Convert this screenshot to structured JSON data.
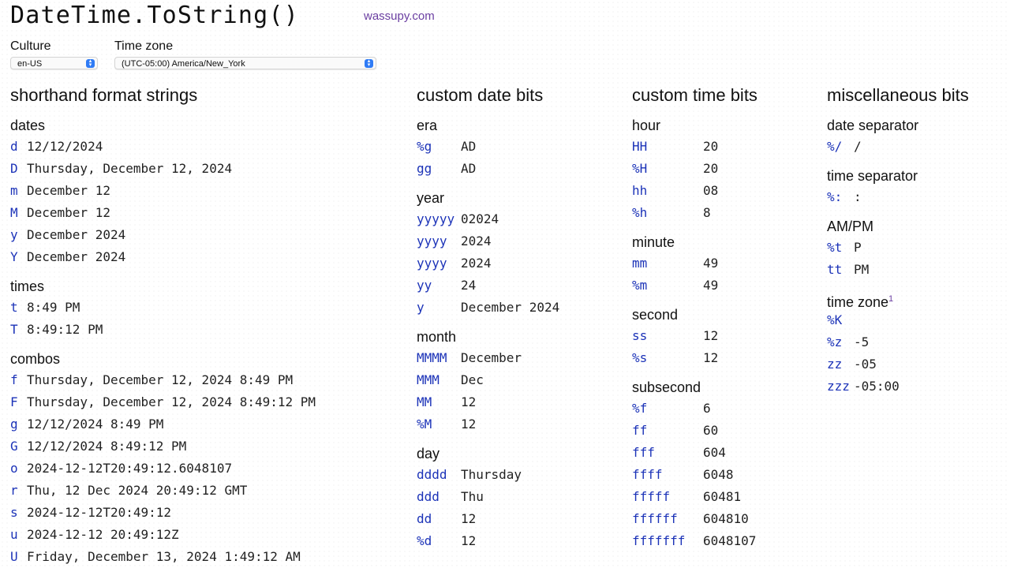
{
  "header": {
    "title": "DateTime.ToString()",
    "site_link": "wassupy.com"
  },
  "controls": {
    "culture_label": "Culture",
    "culture_value": "en-US",
    "timezone_label": "Time zone",
    "timezone_value": "(UTC-05:00) America/New_York"
  },
  "shorthand": {
    "heading": "shorthand format strings",
    "groups": [
      {
        "label": "dates",
        "rows": [
          {
            "code": "d",
            "value": "12/12/2024"
          },
          {
            "code": "D",
            "value": "Thursday, December 12, 2024"
          },
          {
            "code": "m",
            "value": "December 12"
          },
          {
            "code": "M",
            "value": "December 12"
          },
          {
            "code": "y",
            "value": "December 2024"
          },
          {
            "code": "Y",
            "value": "December 2024"
          }
        ]
      },
      {
        "label": "times",
        "rows": [
          {
            "code": "t",
            "value": "8:49 PM"
          },
          {
            "code": "T",
            "value": "8:49:12 PM"
          }
        ]
      },
      {
        "label": "combos",
        "rows": [
          {
            "code": "f",
            "value": "Thursday, December 12, 2024 8:49 PM"
          },
          {
            "code": "F",
            "value": "Thursday, December 12, 2024 8:49:12 PM"
          },
          {
            "code": "g",
            "value": "12/12/2024 8:49 PM"
          },
          {
            "code": "G",
            "value": "12/12/2024 8:49:12 PM"
          },
          {
            "code": "o",
            "value": "2024-12-12T20:49:12.6048107"
          },
          {
            "code": "r",
            "value": "Thu, 12 Dec 2024 20:49:12 GMT"
          },
          {
            "code": "s",
            "value": "2024-12-12T20:49:12"
          },
          {
            "code": "u",
            "value": "2024-12-12 20:49:12Z"
          },
          {
            "code": "U",
            "value": "Friday, December 13, 2024 1:49:12 AM"
          }
        ]
      }
    ]
  },
  "custom_date": {
    "heading": "custom date bits",
    "groups": [
      {
        "label": "era",
        "rows": [
          {
            "code": "%g",
            "value": "AD"
          },
          {
            "code": "gg",
            "value": "AD"
          }
        ]
      },
      {
        "label": "year",
        "rows": [
          {
            "code": "yyyyy",
            "value": "02024"
          },
          {
            "code": "yyyy",
            "value": "2024"
          },
          {
            "code": "yyyy",
            "value": "2024"
          },
          {
            "code": "yy",
            "value": "24"
          },
          {
            "code": "y",
            "value": "December 2024"
          }
        ]
      },
      {
        "label": "month",
        "rows": [
          {
            "code": "MMMM",
            "value": "December"
          },
          {
            "code": "MMM",
            "value": "Dec"
          },
          {
            "code": "MM",
            "value": "12"
          },
          {
            "code": "%M",
            "value": "12"
          }
        ]
      },
      {
        "label": "day",
        "rows": [
          {
            "code": "dddd",
            "value": "Thursday"
          },
          {
            "code": "ddd",
            "value": "Thu"
          },
          {
            "code": "dd",
            "value": "12"
          },
          {
            "code": "%d",
            "value": "12"
          }
        ]
      }
    ]
  },
  "custom_time": {
    "heading": "custom time bits",
    "groups": [
      {
        "label": "hour",
        "rows": [
          {
            "code": "HH",
            "value": "20"
          },
          {
            "code": "%H",
            "value": "20"
          },
          {
            "code": "hh",
            "value": "08"
          },
          {
            "code": "%h",
            "value": "8"
          }
        ]
      },
      {
        "label": "minute",
        "rows": [
          {
            "code": "mm",
            "value": "49"
          },
          {
            "code": "%m",
            "value": "49"
          }
        ]
      },
      {
        "label": "second",
        "rows": [
          {
            "code": "ss",
            "value": "12"
          },
          {
            "code": "%s",
            "value": "12"
          }
        ]
      },
      {
        "label": "subsecond",
        "rows": [
          {
            "code": "%f",
            "value": "6"
          },
          {
            "code": "ff",
            "value": "60"
          },
          {
            "code": "fff",
            "value": "604"
          },
          {
            "code": "ffff",
            "value": "6048"
          },
          {
            "code": "fffff",
            "value": "60481"
          },
          {
            "code": "ffffff",
            "value": "604810"
          },
          {
            "code": "fffffff",
            "value": "6048107"
          }
        ]
      }
    ]
  },
  "misc": {
    "heading": "miscellaneous bits",
    "groups": [
      {
        "label": "date separator",
        "rows": [
          {
            "code": "%/",
            "value": "/"
          }
        ]
      },
      {
        "label": "time separator",
        "rows": [
          {
            "code": "%:",
            "value": ":"
          }
        ]
      },
      {
        "label": "AM/PM",
        "rows": [
          {
            "code": "%t",
            "value": "P"
          },
          {
            "code": "tt",
            "value": "PM"
          }
        ]
      },
      {
        "label": "time zone",
        "footnote": "1",
        "rows": [
          {
            "code": "%K",
            "value": ""
          },
          {
            "code": "%z",
            "value": "-5"
          },
          {
            "code": "zz",
            "value": "-05"
          },
          {
            "code": "zzz",
            "value": "-05:00"
          }
        ]
      }
    ]
  }
}
